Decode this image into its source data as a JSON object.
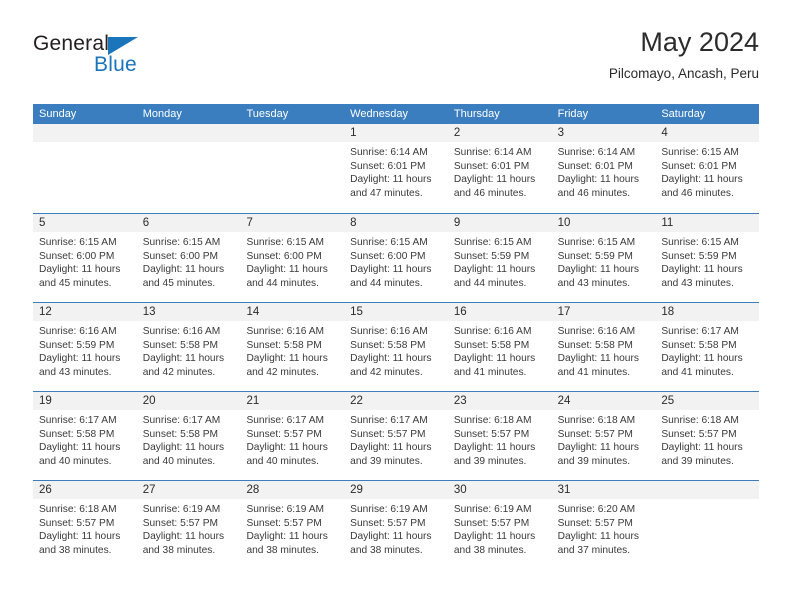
{
  "brand": {
    "name_top": "General",
    "name_bottom": "Blue",
    "accent_color": "#1b75bb"
  },
  "header": {
    "title": "May 2024",
    "subtitle": "Pilcomayo, Ancash, Peru"
  },
  "theme": {
    "header_row_bg": "#3a7ebf",
    "daynum_bg": "#f2f2f2",
    "grid_line": "#3a7ebf",
    "text": "#2b2b2b"
  },
  "calendar": {
    "weekday_headers": [
      "Sunday",
      "Monday",
      "Tuesday",
      "Wednesday",
      "Thursday",
      "Friday",
      "Saturday"
    ],
    "weeks": [
      [
        {
          "day": "",
          "empty": true,
          "sunrise": "",
          "sunset": "",
          "daylight_line1": "",
          "daylight_line2": ""
        },
        {
          "day": "",
          "empty": true,
          "sunrise": "",
          "sunset": "",
          "daylight_line1": "",
          "daylight_line2": ""
        },
        {
          "day": "",
          "empty": true,
          "sunrise": "",
          "sunset": "",
          "daylight_line1": "",
          "daylight_line2": ""
        },
        {
          "day": "1",
          "empty": false,
          "sunrise": "Sunrise: 6:14 AM",
          "sunset": "Sunset: 6:01 PM",
          "daylight_line1": "Daylight: 11 hours",
          "daylight_line2": "and 47 minutes."
        },
        {
          "day": "2",
          "empty": false,
          "sunrise": "Sunrise: 6:14 AM",
          "sunset": "Sunset: 6:01 PM",
          "daylight_line1": "Daylight: 11 hours",
          "daylight_line2": "and 46 minutes."
        },
        {
          "day": "3",
          "empty": false,
          "sunrise": "Sunrise: 6:14 AM",
          "sunset": "Sunset: 6:01 PM",
          "daylight_line1": "Daylight: 11 hours",
          "daylight_line2": "and 46 minutes."
        },
        {
          "day": "4",
          "empty": false,
          "sunrise": "Sunrise: 6:15 AM",
          "sunset": "Sunset: 6:01 PM",
          "daylight_line1": "Daylight: 11 hours",
          "daylight_line2": "and 46 minutes."
        }
      ],
      [
        {
          "day": "5",
          "empty": false,
          "sunrise": "Sunrise: 6:15 AM",
          "sunset": "Sunset: 6:00 PM",
          "daylight_line1": "Daylight: 11 hours",
          "daylight_line2": "and 45 minutes."
        },
        {
          "day": "6",
          "empty": false,
          "sunrise": "Sunrise: 6:15 AM",
          "sunset": "Sunset: 6:00 PM",
          "daylight_line1": "Daylight: 11 hours",
          "daylight_line2": "and 45 minutes."
        },
        {
          "day": "7",
          "empty": false,
          "sunrise": "Sunrise: 6:15 AM",
          "sunset": "Sunset: 6:00 PM",
          "daylight_line1": "Daylight: 11 hours",
          "daylight_line2": "and 44 minutes."
        },
        {
          "day": "8",
          "empty": false,
          "sunrise": "Sunrise: 6:15 AM",
          "sunset": "Sunset: 6:00 PM",
          "daylight_line1": "Daylight: 11 hours",
          "daylight_line2": "and 44 minutes."
        },
        {
          "day": "9",
          "empty": false,
          "sunrise": "Sunrise: 6:15 AM",
          "sunset": "Sunset: 5:59 PM",
          "daylight_line1": "Daylight: 11 hours",
          "daylight_line2": "and 44 minutes."
        },
        {
          "day": "10",
          "empty": false,
          "sunrise": "Sunrise: 6:15 AM",
          "sunset": "Sunset: 5:59 PM",
          "daylight_line1": "Daylight: 11 hours",
          "daylight_line2": "and 43 minutes."
        },
        {
          "day": "11",
          "empty": false,
          "sunrise": "Sunrise: 6:15 AM",
          "sunset": "Sunset: 5:59 PM",
          "daylight_line1": "Daylight: 11 hours",
          "daylight_line2": "and 43 minutes."
        }
      ],
      [
        {
          "day": "12",
          "empty": false,
          "sunrise": "Sunrise: 6:16 AM",
          "sunset": "Sunset: 5:59 PM",
          "daylight_line1": "Daylight: 11 hours",
          "daylight_line2": "and 43 minutes."
        },
        {
          "day": "13",
          "empty": false,
          "sunrise": "Sunrise: 6:16 AM",
          "sunset": "Sunset: 5:58 PM",
          "daylight_line1": "Daylight: 11 hours",
          "daylight_line2": "and 42 minutes."
        },
        {
          "day": "14",
          "empty": false,
          "sunrise": "Sunrise: 6:16 AM",
          "sunset": "Sunset: 5:58 PM",
          "daylight_line1": "Daylight: 11 hours",
          "daylight_line2": "and 42 minutes."
        },
        {
          "day": "15",
          "empty": false,
          "sunrise": "Sunrise: 6:16 AM",
          "sunset": "Sunset: 5:58 PM",
          "daylight_line1": "Daylight: 11 hours",
          "daylight_line2": "and 42 minutes."
        },
        {
          "day": "16",
          "empty": false,
          "sunrise": "Sunrise: 6:16 AM",
          "sunset": "Sunset: 5:58 PM",
          "daylight_line1": "Daylight: 11 hours",
          "daylight_line2": "and 41 minutes."
        },
        {
          "day": "17",
          "empty": false,
          "sunrise": "Sunrise: 6:16 AM",
          "sunset": "Sunset: 5:58 PM",
          "daylight_line1": "Daylight: 11 hours",
          "daylight_line2": "and 41 minutes."
        },
        {
          "day": "18",
          "empty": false,
          "sunrise": "Sunrise: 6:17 AM",
          "sunset": "Sunset: 5:58 PM",
          "daylight_line1": "Daylight: 11 hours",
          "daylight_line2": "and 41 minutes."
        }
      ],
      [
        {
          "day": "19",
          "empty": false,
          "sunrise": "Sunrise: 6:17 AM",
          "sunset": "Sunset: 5:58 PM",
          "daylight_line1": "Daylight: 11 hours",
          "daylight_line2": "and 40 minutes."
        },
        {
          "day": "20",
          "empty": false,
          "sunrise": "Sunrise: 6:17 AM",
          "sunset": "Sunset: 5:58 PM",
          "daylight_line1": "Daylight: 11 hours",
          "daylight_line2": "and 40 minutes."
        },
        {
          "day": "21",
          "empty": false,
          "sunrise": "Sunrise: 6:17 AM",
          "sunset": "Sunset: 5:57 PM",
          "daylight_line1": "Daylight: 11 hours",
          "daylight_line2": "and 40 minutes."
        },
        {
          "day": "22",
          "empty": false,
          "sunrise": "Sunrise: 6:17 AM",
          "sunset": "Sunset: 5:57 PM",
          "daylight_line1": "Daylight: 11 hours",
          "daylight_line2": "and 39 minutes."
        },
        {
          "day": "23",
          "empty": false,
          "sunrise": "Sunrise: 6:18 AM",
          "sunset": "Sunset: 5:57 PM",
          "daylight_line1": "Daylight: 11 hours",
          "daylight_line2": "and 39 minutes."
        },
        {
          "day": "24",
          "empty": false,
          "sunrise": "Sunrise: 6:18 AM",
          "sunset": "Sunset: 5:57 PM",
          "daylight_line1": "Daylight: 11 hours",
          "daylight_line2": "and 39 minutes."
        },
        {
          "day": "25",
          "empty": false,
          "sunrise": "Sunrise: 6:18 AM",
          "sunset": "Sunset: 5:57 PM",
          "daylight_line1": "Daylight: 11 hours",
          "daylight_line2": "and 39 minutes."
        }
      ],
      [
        {
          "day": "26",
          "empty": false,
          "sunrise": "Sunrise: 6:18 AM",
          "sunset": "Sunset: 5:57 PM",
          "daylight_line1": "Daylight: 11 hours",
          "daylight_line2": "and 38 minutes."
        },
        {
          "day": "27",
          "empty": false,
          "sunrise": "Sunrise: 6:19 AM",
          "sunset": "Sunset: 5:57 PM",
          "daylight_line1": "Daylight: 11 hours",
          "daylight_line2": "and 38 minutes."
        },
        {
          "day": "28",
          "empty": false,
          "sunrise": "Sunrise: 6:19 AM",
          "sunset": "Sunset: 5:57 PM",
          "daylight_line1": "Daylight: 11 hours",
          "daylight_line2": "and 38 minutes."
        },
        {
          "day": "29",
          "empty": false,
          "sunrise": "Sunrise: 6:19 AM",
          "sunset": "Sunset: 5:57 PM",
          "daylight_line1": "Daylight: 11 hours",
          "daylight_line2": "and 38 minutes."
        },
        {
          "day": "30",
          "empty": false,
          "sunrise": "Sunrise: 6:19 AM",
          "sunset": "Sunset: 5:57 PM",
          "daylight_line1": "Daylight: 11 hours",
          "daylight_line2": "and 38 minutes."
        },
        {
          "day": "31",
          "empty": false,
          "sunrise": "Sunrise: 6:20 AM",
          "sunset": "Sunset: 5:57 PM",
          "daylight_line1": "Daylight: 11 hours",
          "daylight_line2": "and 37 minutes."
        },
        {
          "day": "",
          "empty": true,
          "sunrise": "",
          "sunset": "",
          "daylight_line1": "",
          "daylight_line2": ""
        }
      ]
    ]
  }
}
